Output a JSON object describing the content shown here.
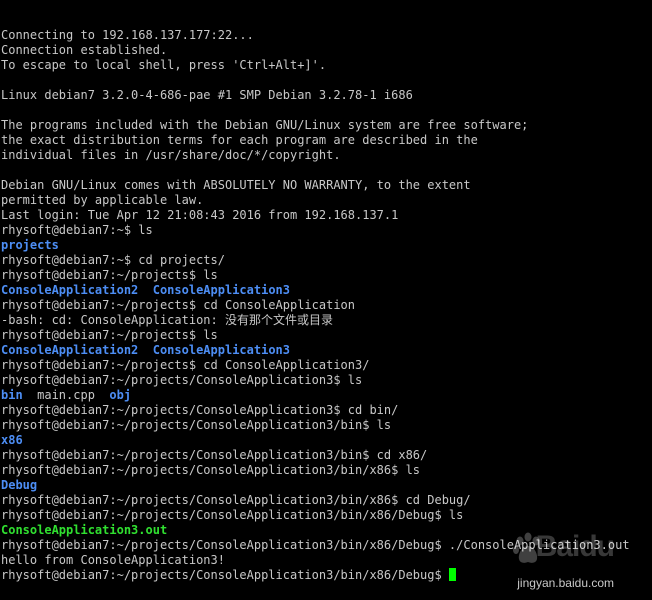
{
  "terminal": {
    "colors": {
      "background": "#000000",
      "text": "#c8c8c8",
      "directory": "#4d8ef5",
      "executable": "#30e030",
      "cursor": "#00ff00"
    },
    "lines": [
      [
        {
          "t": "Connecting to 192.168.137.177:22..."
        }
      ],
      [
        {
          "t": "Connection established."
        }
      ],
      [
        {
          "t": "To escape to local shell, press 'Ctrl+Alt+]'."
        }
      ],
      [],
      [
        {
          "t": "Linux debian7 3.2.0-4-686-pae #1 SMP Debian 3.2.78-1 i686"
        }
      ],
      [],
      [
        {
          "t": "The programs included with the Debian GNU/Linux system are free software;"
        }
      ],
      [
        {
          "t": "the exact distribution terms for each program are described in the"
        }
      ],
      [
        {
          "t": "individual files in /usr/share/doc/*/copyright."
        }
      ],
      [],
      [
        {
          "t": "Debian GNU/Linux comes with ABSOLUTELY NO WARRANTY, to the extent"
        }
      ],
      [
        {
          "t": "permitted by applicable law."
        }
      ],
      [
        {
          "t": "Last login: Tue Apr 12 21:08:43 2016 from 192.168.137.1"
        }
      ],
      [
        {
          "t": "rhysoft@debian7:~$ ls"
        }
      ],
      [
        {
          "t": "projects",
          "c": "dir"
        }
      ],
      [
        {
          "t": "rhysoft@debian7:~$ cd projects/"
        }
      ],
      [
        {
          "t": "rhysoft@debian7:~/projects$ ls"
        }
      ],
      [
        {
          "t": "ConsoleApplication2",
          "c": "dir"
        },
        {
          "t": "  "
        },
        {
          "t": "ConsoleApplication3",
          "c": "dir"
        }
      ],
      [
        {
          "t": "rhysoft@debian7:~/projects$ cd ConsoleApplication"
        }
      ],
      [
        {
          "t": "-bash: cd: ConsoleApplication: 没有那个文件或目录"
        }
      ],
      [
        {
          "t": "rhysoft@debian7:~/projects$ ls"
        }
      ],
      [
        {
          "t": "ConsoleApplication2",
          "c": "dir"
        },
        {
          "t": "  "
        },
        {
          "t": "ConsoleApplication3",
          "c": "dir"
        }
      ],
      [
        {
          "t": "rhysoft@debian7:~/projects$ cd ConsoleApplication3/"
        }
      ],
      [
        {
          "t": "rhysoft@debian7:~/projects/ConsoleApplication3$ ls"
        }
      ],
      [
        {
          "t": "bin",
          "c": "dir"
        },
        {
          "t": "  main.cpp  "
        },
        {
          "t": "obj",
          "c": "dir"
        }
      ],
      [
        {
          "t": "rhysoft@debian7:~/projects/ConsoleApplication3$ cd bin/"
        }
      ],
      [
        {
          "t": "rhysoft@debian7:~/projects/ConsoleApplication3/bin$ ls"
        }
      ],
      [
        {
          "t": "x86",
          "c": "dir"
        }
      ],
      [
        {
          "t": "rhysoft@debian7:~/projects/ConsoleApplication3/bin$ cd x86/"
        }
      ],
      [
        {
          "t": "rhysoft@debian7:~/projects/ConsoleApplication3/bin/x86$ ls"
        }
      ],
      [
        {
          "t": "Debug",
          "c": "dir"
        }
      ],
      [
        {
          "t": "rhysoft@debian7:~/projects/ConsoleApplication3/bin/x86$ cd Debug/"
        }
      ],
      [
        {
          "t": "rhysoft@debian7:~/projects/ConsoleApplication3/bin/x86/Debug$ ls"
        }
      ],
      [
        {
          "t": "ConsoleApplication3.out",
          "c": "exe"
        }
      ],
      [
        {
          "t": "rhysoft@debian7:~/projects/ConsoleApplication3/bin/x86/Debug$ ./ConsoleApplication3.out"
        }
      ],
      [
        {
          "t": "hello from ConsoleApplication3!"
        }
      ],
      [
        {
          "t": "rhysoft@debian7:~/projects/ConsoleApplication3/bin/x86/Debug$ "
        },
        {
          "cursor": true
        }
      ]
    ]
  },
  "watermark": {
    "logo": "Baidu",
    "logo_icon": "baidu-paw-icon",
    "url": "jingyan.baidu.com"
  }
}
